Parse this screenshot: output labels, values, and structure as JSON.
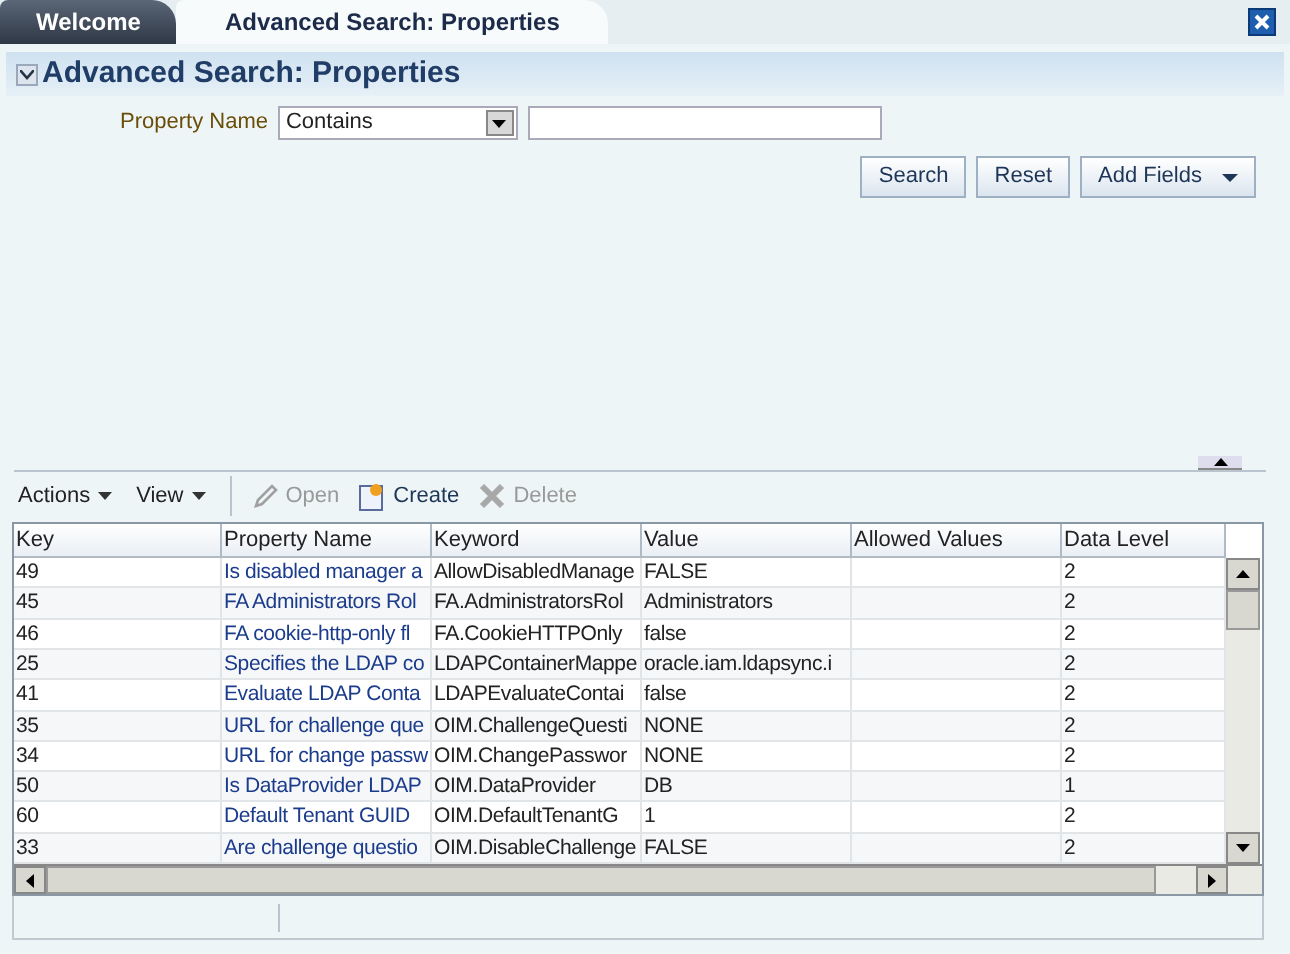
{
  "tabs": [
    {
      "label": "Welcome",
      "selected": false
    },
    {
      "label": "Advanced Search: Properties",
      "selected": true
    }
  ],
  "panel": {
    "title": "Advanced Search: Properties",
    "expanded": true
  },
  "search": {
    "label": "Property Name",
    "operator": "Contains"
  },
  "buttons": [
    "Search",
    "Reset",
    "Add Fields"
  ],
  "toolbar": {
    "menus": [
      "Actions",
      "View"
    ],
    "actions": [
      {
        "label": "Open",
        "disabled": true,
        "kind": "open"
      },
      {
        "label": "Create",
        "disabled": false,
        "kind": "create"
      },
      {
        "label": "Delete",
        "disabled": true,
        "kind": "delete"
      }
    ]
  },
  "table": {
    "columns": [
      "Key",
      "Property Name",
      "Keyword",
      "Value",
      "Allowed Values",
      "Data Level"
    ],
    "rows": [
      [
        "49",
        "Is disabled manager a",
        "AllowDisabledManage",
        "FALSE",
        "",
        "2"
      ],
      [
        "45",
        "FA Administrators Rol",
        "FA.AdministratorsRol",
        "Administrators",
        "",
        "2"
      ],
      [
        "46",
        "FA cookie-http-only fl",
        "FA.CookieHTTPOnly",
        "false",
        "",
        "2"
      ],
      [
        "25",
        "Specifies the LDAP co",
        "LDAPContainerMappe",
        "oracle.iam.ldapsync.i",
        "",
        "2"
      ],
      [
        "41",
        "Evaluate LDAP Conta",
        "LDAPEvaluateContai",
        "false",
        "",
        "2"
      ],
      [
        "35",
        "URL for challenge que",
        "OIM.ChallengeQuesti",
        "NONE",
        "",
        "2"
      ],
      [
        "34",
        "URL for change passw",
        "OIM.ChangePasswor",
        "NONE",
        "",
        "2"
      ],
      [
        "50",
        "Is DataProvider LDAP",
        "OIM.DataProvider",
        "DB",
        "",
        "1"
      ],
      [
        "60",
        "Default Tenant GUID",
        "OIM.DefaultTenantG",
        "1",
        "",
        "2"
      ],
      [
        "33",
        "Are challenge questio",
        "OIM.DisableChallenge",
        "FALSE",
        "",
        "2"
      ]
    ]
  }
}
